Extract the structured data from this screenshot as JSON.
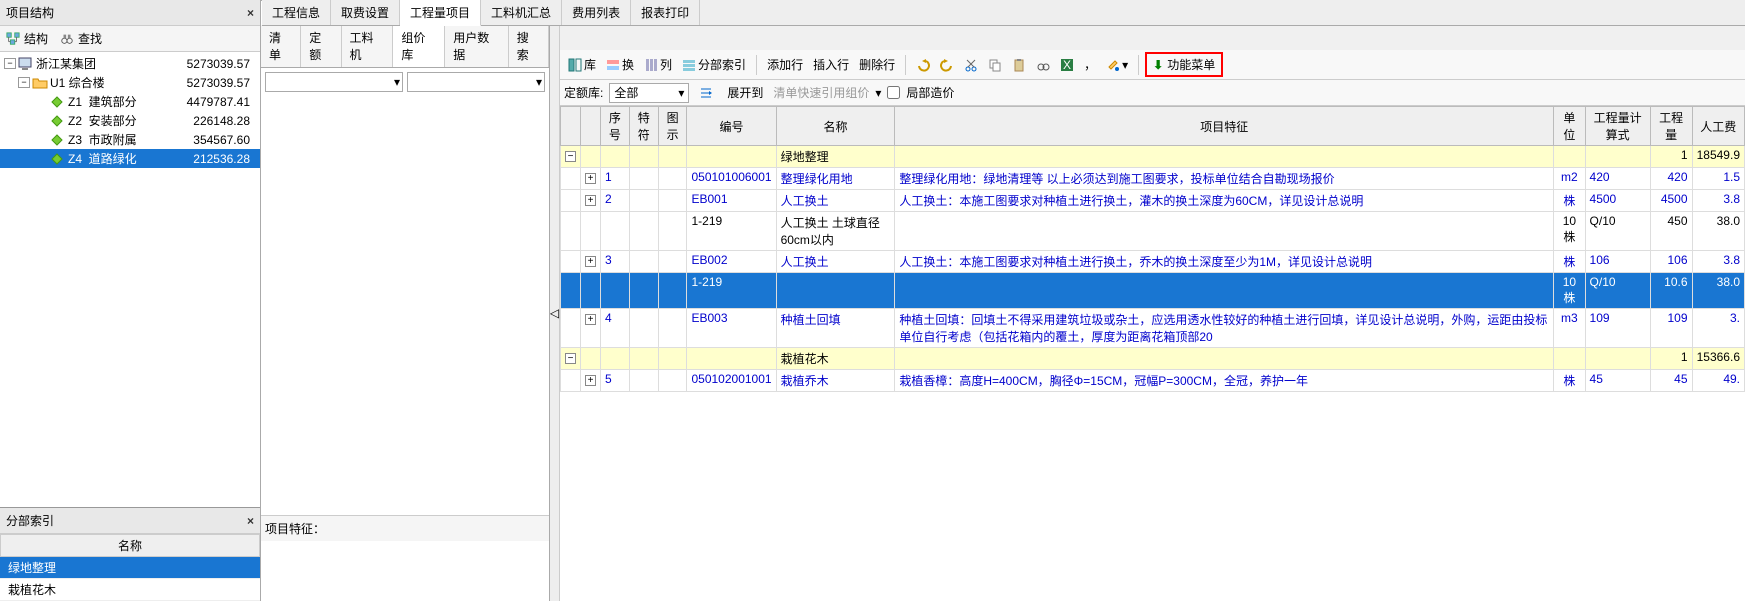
{
  "panels": {
    "structure_title": "项目结构",
    "structure_tabs": {
      "structure": "结构",
      "find": "查找"
    },
    "section_index_title": "分部索引",
    "name_col": "名称",
    "feature_label": "项目特征："
  },
  "tree": {
    "root": {
      "label": "浙江某集团",
      "value": "5273039.57"
    },
    "u1": {
      "label": "U1  综合楼",
      "value": "5273039.57"
    },
    "children": [
      {
        "code": "Z1",
        "label": "建筑部分",
        "value": "4479787.41"
      },
      {
        "code": "Z2",
        "label": "安装部分",
        "value": "226148.28"
      },
      {
        "code": "Z3",
        "label": "市政附属",
        "value": "354567.60"
      },
      {
        "code": "Z4",
        "label": "道路绿化",
        "value": "212536.28",
        "selected": true
      }
    ]
  },
  "section_index": [
    {
      "label": "绿地整理",
      "selected": true
    },
    {
      "label": "栽植花木"
    }
  ],
  "top_tabs": [
    "工程信息",
    "取费设置",
    "工程量项目",
    "工料机汇总",
    "费用列表",
    "报表打印"
  ],
  "top_active": 2,
  "sub_tabs": [
    "清单",
    "定额",
    "工料机",
    "组价库",
    "用户数据",
    "搜索"
  ],
  "sub_active": 3,
  "toolbar": {
    "ku": "库",
    "huan": "换",
    "lie": "列",
    "section_idx": "分部索引",
    "add_row": "添加行",
    "insert_row": "插入行",
    "delete_row": "删除行",
    "comma": "，",
    "func_menu": "功能菜单"
  },
  "filter": {
    "lib_label": "定额库:",
    "lib_value": "全部",
    "expand": "展开到",
    "quick": "清单快速引用组价",
    "local_cost": "局部造价"
  },
  "grid": {
    "headers": [
      "序号",
      "特符",
      "图示",
      "编号",
      "名称",
      "项目特征",
      "单位",
      "工程量计算式",
      "工程量",
      "人工费"
    ],
    "rows": [
      {
        "type": "group",
        "name": "绿地整理",
        "qty": "1",
        "labor": "18549.9"
      },
      {
        "type": "item",
        "idx": "1",
        "code": "050101006001",
        "name": "整理绿化用地",
        "feature": "整理绿化用地：绿地清理等 以上必须达到施工图要求，投标单位结合自勘现场报价",
        "unit": "m2",
        "formula": "420",
        "qty": "420",
        "labor": "1.5"
      },
      {
        "type": "item",
        "idx": "2",
        "code": "EB001",
        "name": "人工换土",
        "feature": "人工换土：本施工图要求对种植土进行换土，灌木的换土深度为60CM，详见设计总说明",
        "unit": "株",
        "formula": "4500",
        "qty": "4500",
        "labor": "3.8"
      },
      {
        "type": "sub",
        "code": "1-219",
        "name": "人工换土  土球直径60cm以内",
        "unit": "10株",
        "formula": "Q/10",
        "qty": "450",
        "labor": "38.0"
      },
      {
        "type": "item",
        "idx": "3",
        "code": "EB002",
        "name": "人工换土",
        "feature": "人工换土：本施工图要求对种植土进行换土，乔木的换土深度至少为1M，详见设计总说明",
        "unit": "株",
        "formula": "106",
        "qty": "106",
        "labor": "3.8"
      },
      {
        "type": "sub",
        "code": "1-219",
        "unit": "10株",
        "formula": "Q/10",
        "qty": "10.6",
        "labor": "38.0",
        "selected": true
      },
      {
        "type": "item",
        "idx": "4",
        "code": "EB003",
        "name": "种植土回填",
        "feature": "种植土回填：回填土不得采用建筑垃圾或杂土，应选用透水性较好的种植土进行回填，详见设计总说明，外购，运距由投标单位自行考虑（包括花箱内的覆土，厚度为距离花箱顶部20",
        "unit": "m3",
        "formula": "109",
        "qty": "109",
        "labor": "3."
      },
      {
        "type": "group",
        "name": "栽植花木",
        "qty": "1",
        "labor": "15366.6"
      },
      {
        "type": "item",
        "idx": "5",
        "code": "050102001001",
        "name": "栽植乔木",
        "feature": "栽植香樟：高度H=400CM，胸径Φ=15CM，冠幅P=300CM，全冠，养护一年",
        "unit": "株",
        "formula": "45",
        "qty": "45",
        "labor": "49."
      }
    ]
  }
}
